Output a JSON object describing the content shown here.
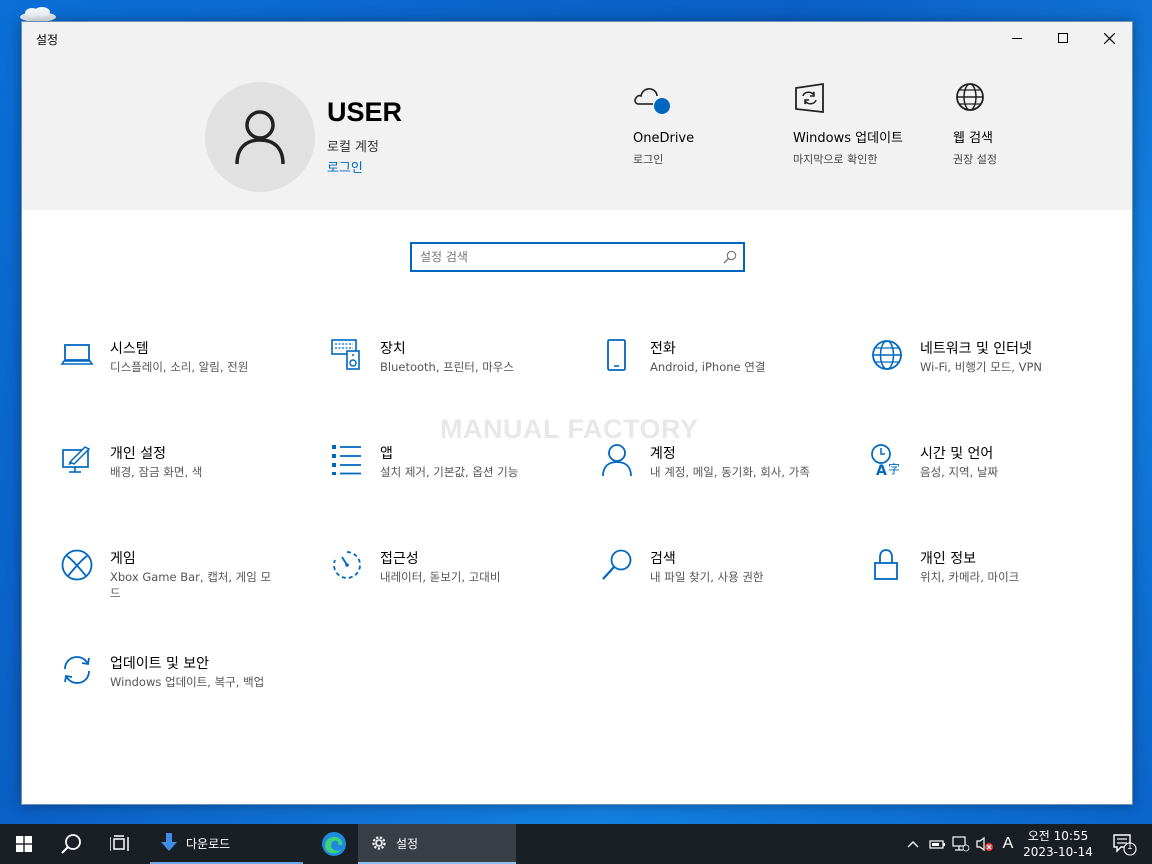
{
  "window": {
    "title": "설정"
  },
  "account": {
    "name": "USER",
    "type": "로컬 계정",
    "login": "로그인"
  },
  "quick": [
    {
      "title": "OneDrive",
      "sub": "로그인",
      "icon": "onedrive-icon"
    },
    {
      "title": "Windows 업데이트",
      "sub": "마지막으로 확인한",
      "icon": "windows-update-icon"
    },
    {
      "title": "웹 검색",
      "sub": "권장 설정",
      "icon": "globe-icon"
    }
  ],
  "search": {
    "placeholder": "설정 검색"
  },
  "watermark": "MANUAL FACTORY",
  "tiles": [
    {
      "title": "시스템",
      "sub": "디스플레이, 소리, 알림, 전원",
      "icon": "laptop-icon"
    },
    {
      "title": "장치",
      "sub": "Bluetooth, 프린터, 마우스",
      "icon": "devices-icon"
    },
    {
      "title": "전화",
      "sub": "Android, iPhone 연결",
      "icon": "phone-icon"
    },
    {
      "title": "네트워크 및 인터넷",
      "sub": "Wi-Fi, 비행기 모드, VPN",
      "icon": "network-globe-icon"
    },
    {
      "title": "개인 설정",
      "sub": "배경, 잠금 화면, 색",
      "icon": "personalization-icon"
    },
    {
      "title": "앱",
      "sub": "설치 제거, 기본값, 옵션 기능",
      "icon": "apps-list-icon"
    },
    {
      "title": "계정",
      "sub": "내 계정, 메일, 동기화, 회사, 가족",
      "icon": "account-person-icon"
    },
    {
      "title": "시간 및 언어",
      "sub": "음성, 지역, 날짜",
      "icon": "time-language-icon"
    },
    {
      "title": "게임",
      "sub": "Xbox Game Bar, 캡처, 게임 모드",
      "icon": "xbox-icon"
    },
    {
      "title": "접근성",
      "sub": "내레이터, 돋보기, 고대비",
      "icon": "accessibility-timer-icon"
    },
    {
      "title": "검색",
      "sub": "내 파일 찾기, 사용 권한",
      "icon": "search-magnifier-icon"
    },
    {
      "title": "개인 정보",
      "sub": "위치, 카메라, 마이크",
      "icon": "lock-icon"
    },
    {
      "title": "업데이트 및 보안",
      "sub": "Windows 업데이트, 복구, 백업",
      "icon": "sync-icon"
    }
  ],
  "taskbar": {
    "downloads_label": "다운로드",
    "settings_label": "설정",
    "time": "오전 10:55",
    "date": "2023-10-14",
    "ime": "A",
    "notification_count": "1"
  },
  "colors": {
    "accent": "#0067c0",
    "taskbar": "#1a1e25"
  }
}
